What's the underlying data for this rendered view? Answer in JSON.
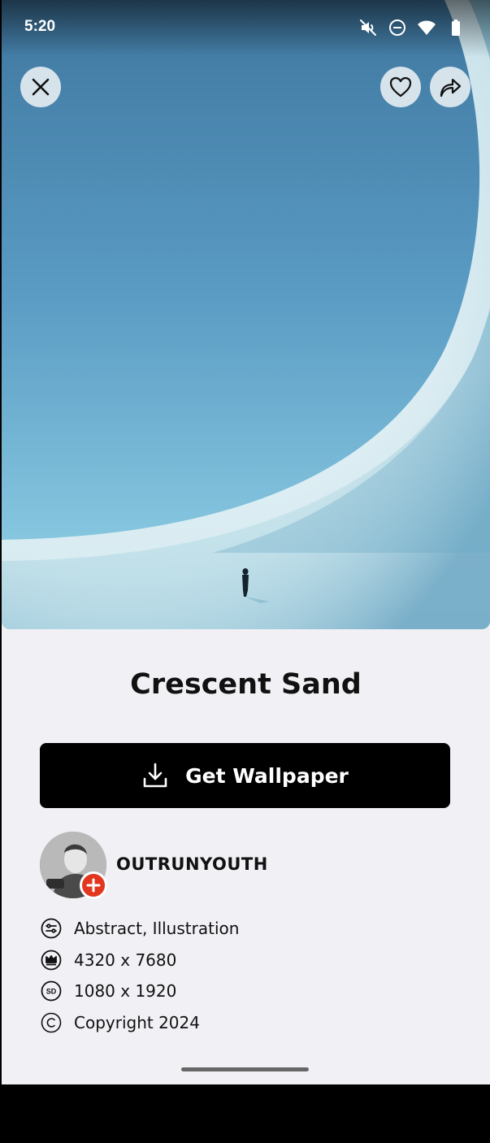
{
  "status_bar": {
    "time": "5:20",
    "icons": [
      "mute-icon",
      "dnd-icon",
      "wifi-icon",
      "battery-icon"
    ]
  },
  "wallpaper": {
    "title": "Crescent Sand",
    "colors": {
      "sky": "#4f8fb8",
      "sand": "#d9eef3"
    }
  },
  "actions": {
    "close_icon": "close-icon",
    "favorite_icon": "heart-icon",
    "share_icon": "share-icon"
  },
  "download": {
    "label": "Get Wallpaper",
    "icon": "download-icon"
  },
  "author": {
    "name": "OUTRUNYOUTH",
    "follow_icon": "plus-icon",
    "badge_color": "#e3361f"
  },
  "details": [
    {
      "icon": "categories-icon",
      "text": "Abstract, Illustration"
    },
    {
      "icon": "crown-icon",
      "text": "4320 x 7680"
    },
    {
      "icon": "sd-icon",
      "text": "1080 x 1920"
    },
    {
      "icon": "copyright-icon",
      "text": "Copyright 2024"
    }
  ]
}
